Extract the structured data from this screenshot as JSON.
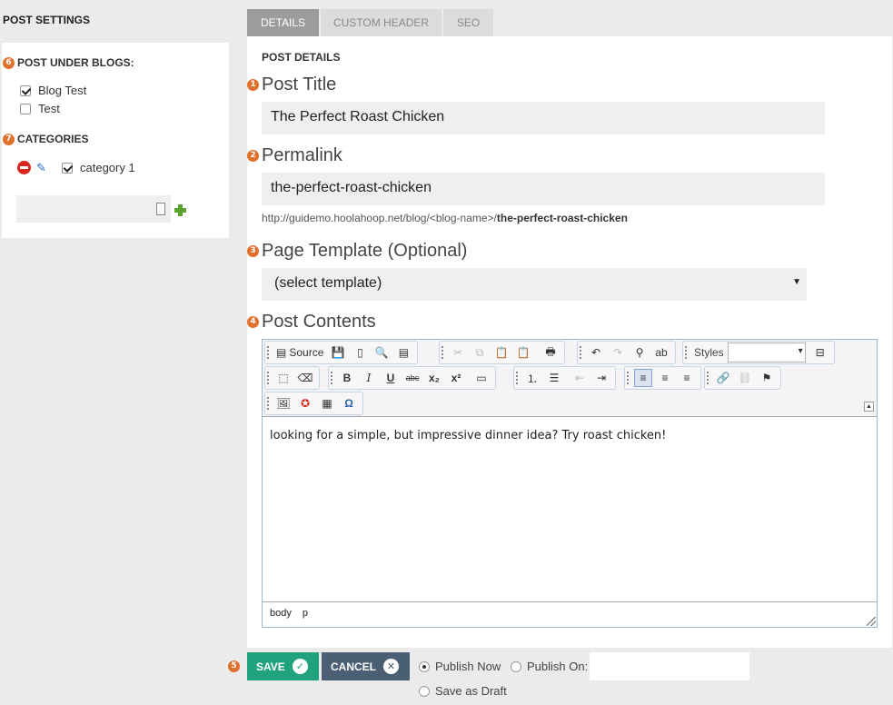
{
  "sidebar": {
    "title": "POST SETTINGS",
    "blogs": {
      "badge": "6",
      "heading": "POST UNDER BLOGS:",
      "items": [
        {
          "label": "Blog Test",
          "checked": true
        },
        {
          "label": "Test",
          "checked": false
        }
      ]
    },
    "categories": {
      "badge": "7",
      "heading": "CATEGORIES",
      "items": [
        {
          "label": "category 1",
          "checked": true
        }
      ],
      "new_category_value": ""
    }
  },
  "tabs": [
    {
      "label": "DETAILS",
      "active": true
    },
    {
      "label": "CUSTOM HEADER",
      "active": false
    },
    {
      "label": "SEO",
      "active": false
    }
  ],
  "main": {
    "section_title": "POST DETAILS",
    "post_title": {
      "badge": "1",
      "label": "Post Title",
      "value": "The Perfect Roast Chicken"
    },
    "permalink": {
      "badge": "2",
      "label": "Permalink",
      "value": "the-perfect-roast-chicken",
      "hint_prefix": "http://guidemo.hoolahoop.net/blog/<blog-name>/",
      "hint_slug": "the-perfect-roast-chicken"
    },
    "template": {
      "badge": "3",
      "label": "Page Template (Optional)",
      "selected": "(select template)"
    },
    "contents": {
      "badge": "4",
      "label": "Post Contents",
      "toolbar": {
        "source_label": "Source",
        "styles_label": "Styles"
      },
      "body_text": "looking for a simple, but impressive dinner idea? Try roast chicken!",
      "status_path": [
        "body",
        "p"
      ]
    }
  },
  "footer": {
    "badge": "5",
    "save_label": "SAVE",
    "cancel_label": "CANCEL",
    "options": {
      "publish_now": "Publish Now",
      "publish_on": "Publish On:",
      "save_as_draft": "Save as Draft",
      "selected": "publish_now"
    },
    "publish_date_value": ""
  },
  "colors": {
    "badge": "#e0702c",
    "save": "#20a27f",
    "cancel": "#4a5f73",
    "tab_active": "#9c9c9c"
  }
}
